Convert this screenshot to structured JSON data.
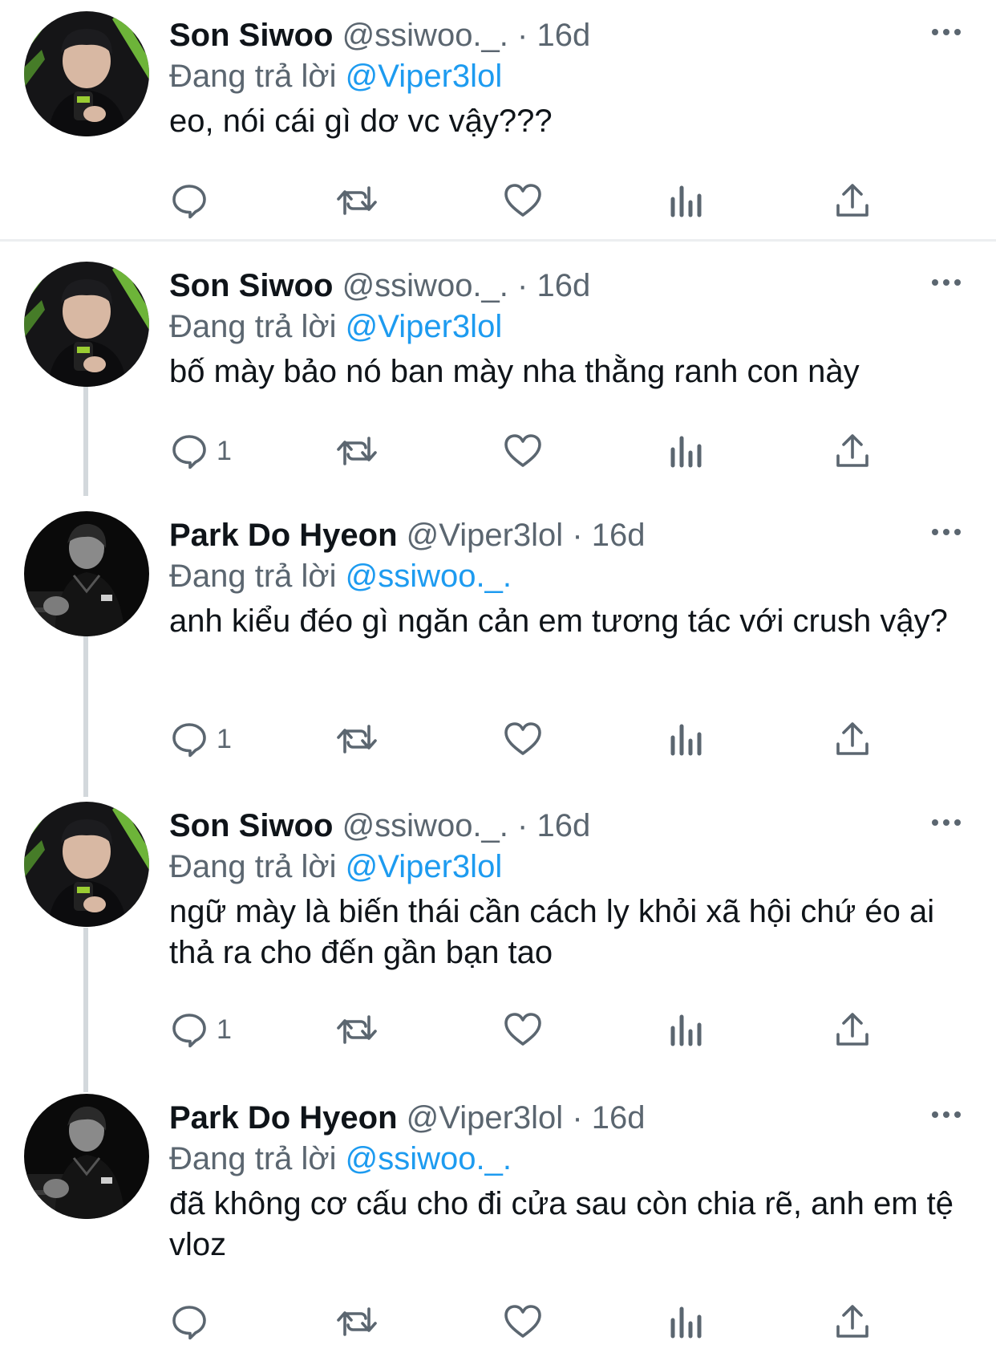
{
  "tweets": [
    {
      "name": "Son Siwoo",
      "handle": "@ssiwoo._.",
      "separator": "·",
      "time": "16d",
      "reply_prefix": "Đang trả lời",
      "reply_to": "@Viper3lol",
      "text": "eo, nói cái gì dơ vc vậy???",
      "reply_count": "",
      "avatar": "siwoo"
    },
    {
      "name": "Son Siwoo",
      "handle": "@ssiwoo._.",
      "separator": "·",
      "time": "16d",
      "reply_prefix": "Đang trả lời",
      "reply_to": "@Viper3lol",
      "text": "bố mày bảo nó ban mày nha thằng ranh con này",
      "reply_count": "1",
      "avatar": "siwoo"
    },
    {
      "name": "Park Do Hyeon",
      "handle": "@Viper3lol",
      "separator": "·",
      "time": "16d",
      "reply_prefix": "Đang trả lời",
      "reply_to": "@ssiwoo._.",
      "text": "anh kiểu đéo gì ngăn cản em tương tác với crush vậy?",
      "reply_count": "1",
      "avatar": "viper"
    },
    {
      "name": "Son Siwoo",
      "handle": "@ssiwoo._.",
      "separator": "·",
      "time": "16d",
      "reply_prefix": "Đang trả lời",
      "reply_to": "@Viper3lol",
      "text": "ngữ mày là biến thái cần cách ly khỏi xã hội chứ éo ai thả ra cho đến gần bạn tao",
      "reply_count": "1",
      "avatar": "siwoo"
    },
    {
      "name": "Park Do Hyeon",
      "handle": "@Viper3lol",
      "separator": "·",
      "time": "16d",
      "reply_prefix": "Đang trả lời",
      "reply_to": "@ssiwoo._.",
      "text": "đã không cơ cấu cho đi cửa sau còn chia rẽ, anh em tệ vloz",
      "reply_count": "",
      "avatar": "viper"
    }
  ],
  "icons": {
    "reply": "reply-icon",
    "retweet": "retweet-icon",
    "like": "heart-icon",
    "views": "analytics-icon",
    "share": "share-icon",
    "more": "more-icon"
  },
  "colors": {
    "text": "#0f1419",
    "secondary": "#5b6670",
    "link": "#1d9bf0",
    "thread_line": "#d3d8dc",
    "divider": "#eceef0"
  }
}
